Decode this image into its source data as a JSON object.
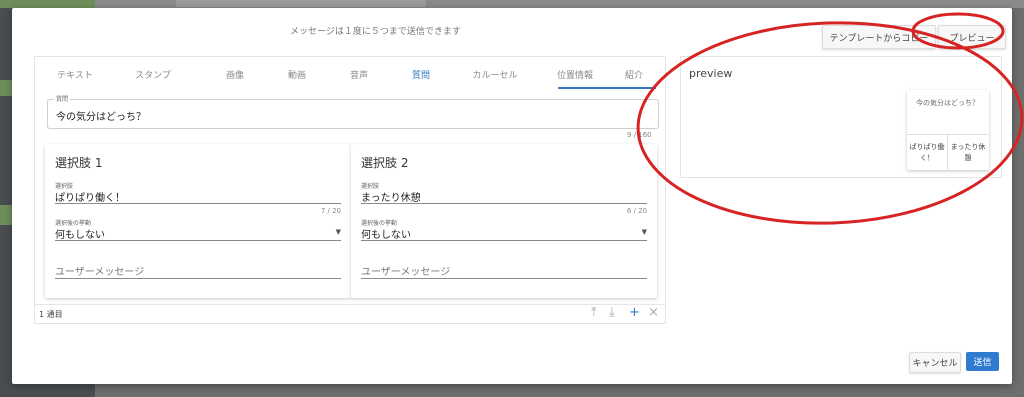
{
  "modal": {
    "notice": "メッセージは１度に５つまで送信できます",
    "copy_button": "テンプレートからコピー",
    "preview_button": "プレビュー"
  },
  "tabs": [
    "テキスト",
    "スタンプ",
    "画像",
    "動画",
    "音声",
    "質問",
    "カルーセル",
    "位置情報",
    "紹介"
  ],
  "active_tab": "質問",
  "question": {
    "legend": "質問",
    "value": "今の気分はどっち？",
    "counter": "9 / 160"
  },
  "choices": [
    {
      "title": "選択肢 1",
      "choice_label": "選択肢",
      "choice_value": "ぱりぱり働く！",
      "counter": "7 / 20",
      "action_label": "選択後の挙動",
      "action_value": "何もしない",
      "user_message_placeholder": "ユーザーメッセージ"
    },
    {
      "title": "選択肢 2",
      "choice_label": "選択肢",
      "choice_value": "まったり休憩",
      "counter": "6 / 20",
      "action_label": "選択後の挙動",
      "action_value": "何もしない",
      "user_message_placeholder": "ユーザーメッセージ"
    }
  ],
  "footer": {
    "page_count": "1 通目",
    "icons": [
      "arrow-up-icon",
      "arrow-down-icon",
      "plus-icon",
      "close-icon"
    ]
  },
  "preview": {
    "title": "preview",
    "bubble_text": "今の気分はどっち？",
    "bubble_buttons": [
      "ぱりぱり働く！",
      "まったり休憩"
    ]
  },
  "actions": {
    "cancel": "キャンセル",
    "send": "送信"
  },
  "colors": {
    "accent": "#2f7bbd",
    "send_button": "#2f7bd0",
    "annotation": "#d62424"
  }
}
